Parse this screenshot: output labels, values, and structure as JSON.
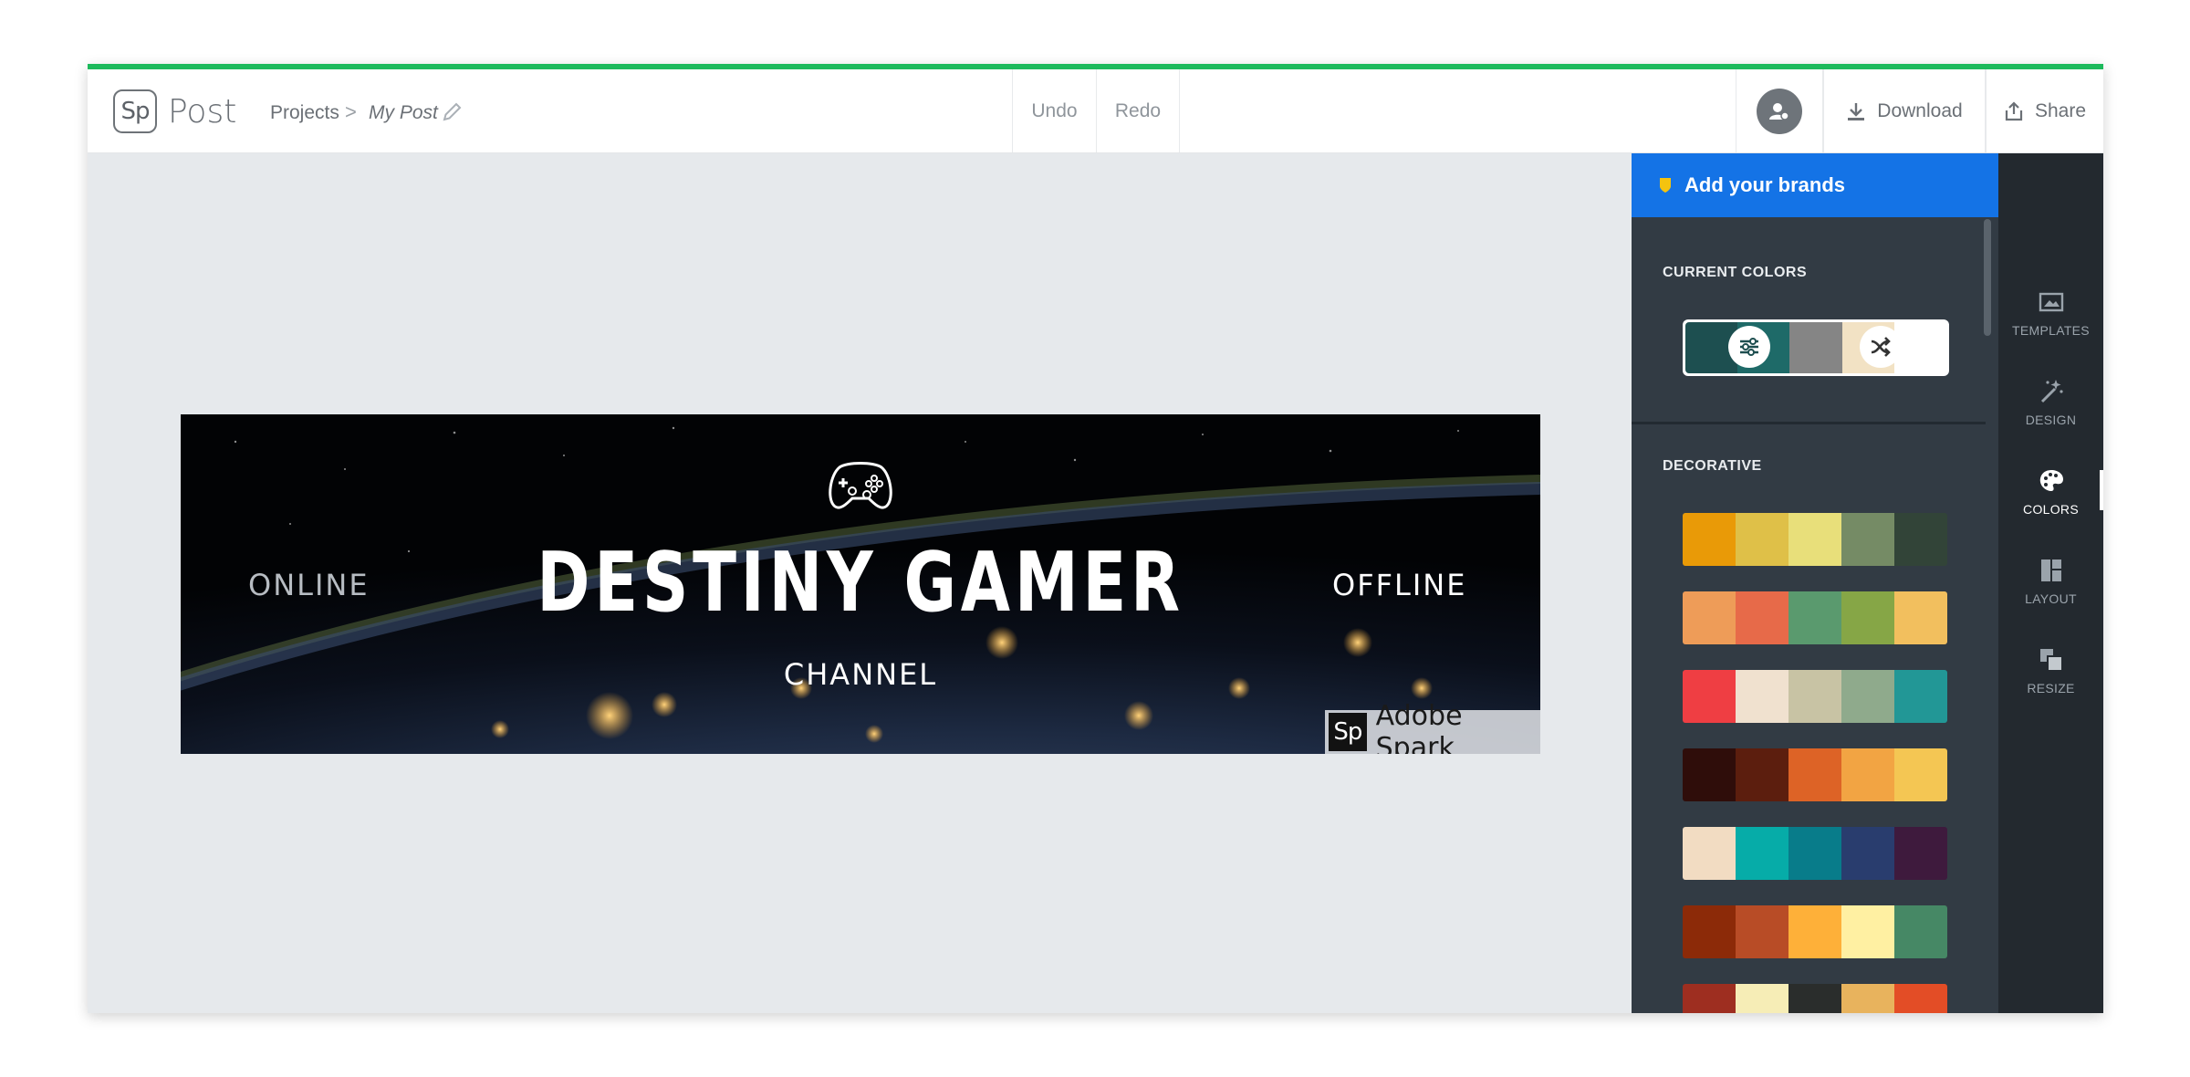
{
  "header": {
    "logo_text": "Sp",
    "app_name": "Post",
    "breadcrumb": {
      "projects": "Projects",
      "separator": ">",
      "current": "My Post"
    },
    "undo_label": "Undo",
    "redo_label": "Redo",
    "download_label": "Download",
    "share_label": "Share",
    "accent_color": "#1dba5c"
  },
  "canvas": {
    "icon": "game-controller-icon",
    "title": "DESTINY GAMER",
    "subtitle": "CHANNEL",
    "left_text": "ONLINE",
    "right_text": "OFFLINE",
    "watermark_logo": "Sp",
    "watermark_text": "Adobe Spark"
  },
  "panel": {
    "brands_label": "Add your brands",
    "brands_color": "#1473e6",
    "current_colors_label": "CURRENT COLORS",
    "current_colors": [
      "#1d4f50",
      "#1e6a68",
      "#858585",
      "#f2e2c4",
      "#ffffff"
    ],
    "decorative_label": "DECORATIVE",
    "palettes": [
      [
        "#e99a07",
        "#dfc048",
        "#e8df7a",
        "#758b65",
        "#324438"
      ],
      [
        "#ee9c58",
        "#e76a49",
        "#5a9a6e",
        "#86a646",
        "#f2bf5e"
      ],
      [
        "#ef3e43",
        "#f0e1cf",
        "#c8c3a4",
        "#8faa8c",
        "#229796"
      ],
      [
        "#2f0d0a",
        "#5c1e0e",
        "#dd6326",
        "#f2a443",
        "#f4c653"
      ],
      [
        "#f2dcc2",
        "#06aca8",
        "#087c8a",
        "#293d6e",
        "#3e1a3d"
      ],
      [
        "#8c2a08",
        "#b84c26",
        "#feb039",
        "#fff0a2",
        "#468865"
      ],
      [
        "#9e2e20",
        "#f6edb6",
        "#2a2d2c",
        "#e8b35d",
        "#e34d26"
      ]
    ]
  },
  "nav": {
    "items": [
      {
        "label": "TEMPLATES",
        "icon": "templates-icon"
      },
      {
        "label": "DESIGN",
        "icon": "magic-wand-icon"
      },
      {
        "label": "COLORS",
        "icon": "palette-icon"
      },
      {
        "label": "LAYOUT",
        "icon": "layout-icon"
      },
      {
        "label": "RESIZE",
        "icon": "resize-icon"
      }
    ],
    "active": "COLORS"
  }
}
